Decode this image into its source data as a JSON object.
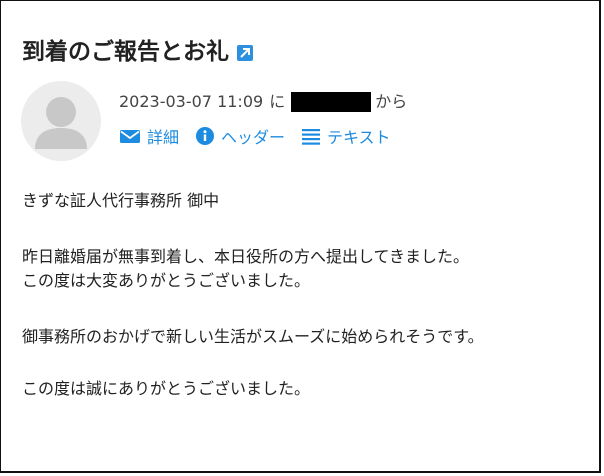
{
  "email": {
    "subject": "到着のご報告とお礼",
    "date": "2023-03-07 11:09",
    "from_prefix": "に",
    "from_suffix": "から",
    "actions": {
      "details": "詳細",
      "headers": "ヘッダー",
      "text": "テキスト"
    },
    "body": {
      "greeting": "きずな証人代行事務所 御中",
      "line1": "昨日離婚届が無事到着し、本日役所の方へ提出してきました。",
      "line2": "この度は大変ありがとうございました。",
      "line3": "御事務所のおかげで新しい生活がスムーズに始められそうです。",
      "line4": "この度は誠にありがとうございました。"
    }
  },
  "colors": {
    "accent": "#1d8be0",
    "redaction": "#000000",
    "avatar_bg": "#ececec",
    "avatar_fg": "#c8c8c8"
  },
  "icons": {
    "subject": "external-link-icon",
    "avatar": "person-icon",
    "details": "envelope-icon",
    "headers": "info-icon",
    "text": "text-lines-icon"
  }
}
